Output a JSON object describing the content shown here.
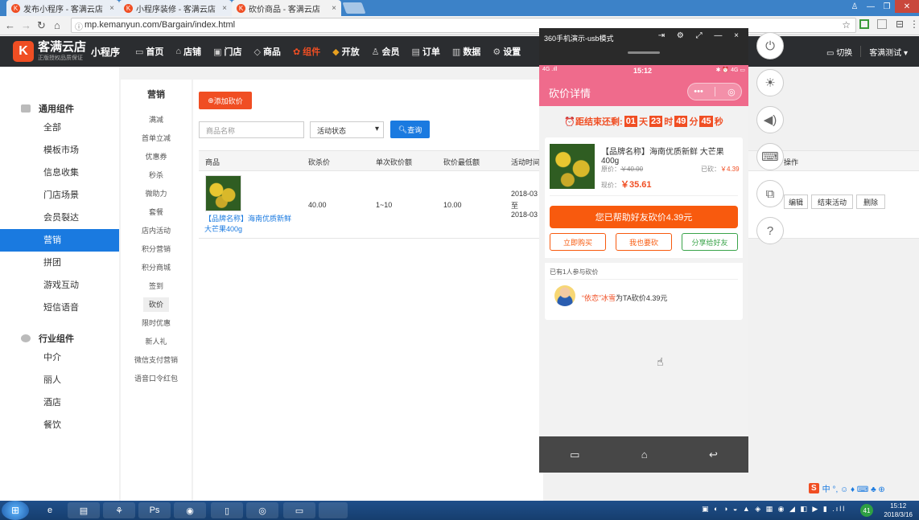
{
  "browser": {
    "tabs": [
      {
        "label": "发布小程序 - 客满云店",
        "fav": "K"
      },
      {
        "label": "小程序装修 - 客满云店",
        "fav": "K"
      },
      {
        "label": "砍价商品 - 客满云店",
        "fav": "K"
      }
    ],
    "url": "mp.kemanyun.com/Bargain/index.html",
    "tab_close": "×"
  },
  "header": {
    "logo_mark": "K",
    "brand": "客满云店",
    "brand_sub": "正版授权品质保证",
    "product": "小程序",
    "nav": [
      {
        "label": "首页",
        "icon": "▭"
      },
      {
        "label": "店铺",
        "icon": "⌂"
      },
      {
        "label": "门店",
        "icon": "▣"
      },
      {
        "label": "商品",
        "icon": "◇"
      },
      {
        "label": "组件",
        "icon": "✿"
      },
      {
        "label": "开放",
        "icon": "◆"
      },
      {
        "label": "会员",
        "icon": "♙"
      },
      {
        "label": "订单",
        "icon": "▤"
      },
      {
        "label": "数据",
        "icon": "▥"
      },
      {
        "label": "设置",
        "icon": "⚙"
      }
    ],
    "switch_label": "切换",
    "account": "客满测试",
    "account_caret": "▾"
  },
  "sidebar": {
    "groups": [
      {
        "label": "通用组件"
      },
      {
        "label": "行业组件"
      }
    ],
    "items1": [
      "全部",
      "模板市场",
      "信息收集",
      "门店场景",
      "会员裂达",
      "营销",
      "拼团",
      "游戏互动",
      "短信语音"
    ],
    "items2": [
      "中介",
      "丽人",
      "酒店",
      "餐饮"
    ]
  },
  "subnav": {
    "title": "营销",
    "items": [
      "满减",
      "首单立减",
      "优惠券",
      "秒杀",
      "微助力",
      "套餐",
      "店内活动",
      "积分营销",
      "积分商城",
      "签到",
      "砍价",
      "限时优惠",
      "新人礼",
      "微信支付营销",
      "语音口令红包"
    ]
  },
  "toolbar": {
    "add_label": "添加砍价",
    "name_placeholder": "商品名称",
    "status_select": "活动状态",
    "query_label": "查询"
  },
  "table": {
    "headers": [
      "商品",
      "砍杀价",
      "单次砍价额",
      "砍价最低额",
      "活动时间",
      "操作"
    ],
    "rows": [
      {
        "name": "【品牌名称】海南优质新鲜大芒果400g",
        "price": "40.00",
        "once": "1~10",
        "min": "10.00",
        "time_start": "2018-03",
        "time_to": "至",
        "time_end": "2018-03",
        "ops": [
          "编辑",
          "结束活动",
          "删除"
        ]
      }
    ]
  },
  "emulator": {
    "title": "360手机演示-usb模式",
    "controls": "⇥ ⚙ ⤢ — ×",
    "status_left": "4G .ıll",
    "status_time": "15:12",
    "status_right": "✱ ⏰ 4G ▭",
    "page_title": "砍价详情",
    "capsule_dots": "•••",
    "capsule_target": "◎",
    "countdown": {
      "icon": "⏰",
      "prefix": "距结束还剩:",
      "d": "01",
      "d_unit": "天",
      "h": "23",
      "h_unit": "时",
      "m": "49",
      "m_unit": "分",
      "s": "45",
      "s_unit": "秒"
    },
    "product": {
      "name": "【品牌名称】海南优质新鲜 大芒果400g",
      "orig_label": "原价：",
      "orig_price": "￥40.00",
      "cut_label": "已砍：",
      "cut_value": "￥4.39",
      "now_label": "现价：",
      "now_price": "￥35.61"
    },
    "main_button": "您已帮助好友砍价4.39元",
    "buttons": [
      "立即购买",
      "我也要砍",
      "分享给好友"
    ],
    "participants_title": "已有1人参与砍价",
    "participant": {
      "name": "“依恋”冰雪",
      "action": "为TA砍价4.39元"
    },
    "navbar": [
      "▭",
      "⌂",
      "↩"
    ]
  },
  "tools": [
    "⏻",
    "☀",
    "◀)",
    "⌨",
    "⧉",
    "?"
  ],
  "taskbar": {
    "apps": [
      "e",
      "▤",
      "⚘",
      "Ps",
      "◉",
      "▯",
      "◎",
      "▭"
    ],
    "clock_time": "15:12",
    "clock_date": "2018/3/16",
    "ime_logo": "S",
    "ime_text": "中 °, ☺ ♦ ⌨ ♣ ⊕",
    "tray": "▣ ◐ ◑ ◒ ▲ ◈ ▦ ◉ ◢ ◧ ▶ ▮ .ıll",
    "tray_badge": "41"
  },
  "colors": {
    "accent": "#f04e23",
    "blue": "#1a7ae0",
    "phone_pink": "#ef6b8c",
    "dark_header": "#2b2d30"
  }
}
